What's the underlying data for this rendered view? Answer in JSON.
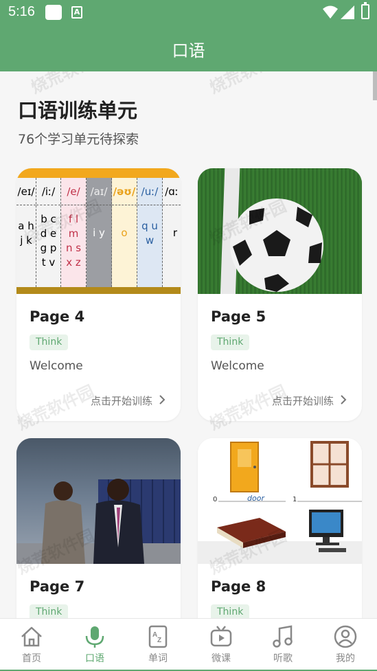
{
  "status_bar": {
    "time": "5:16",
    "a_icon": "A"
  },
  "header": {
    "title": "口语"
  },
  "page": {
    "heading": "口语训练单元",
    "subheading": "76个学习单元待探索"
  },
  "cards": [
    {
      "title": "Page 4",
      "tag": "Think",
      "desc": "Welcome",
      "action": "点击开始训练"
    },
    {
      "title": "Page 5",
      "tag": "Think",
      "desc": "Welcome",
      "action": "点击开始训练"
    },
    {
      "title": "Page 7",
      "tag": "Think"
    },
    {
      "title": "Page 8",
      "tag": "Think"
    }
  ],
  "phonics": {
    "headers": [
      "/eɪ/",
      "/iː/",
      "/e/",
      "/aɪ/",
      "/əʊ/",
      "/uː/",
      "/ɑː"
    ],
    "bodies": [
      [
        "a h",
        "j k"
      ],
      [
        "b c",
        "d e",
        "g p",
        "t v"
      ],
      [
        "f l",
        "m",
        "n s",
        "x z"
      ],
      [
        "i y"
      ],
      [
        "o"
      ],
      [
        "q u",
        "w"
      ],
      [
        "r"
      ]
    ]
  },
  "objects_labels": {
    "n0": "0",
    "word": "door",
    "n1": "1"
  },
  "watermark": "烧荒软件园",
  "nav": {
    "items": [
      {
        "label": "首页",
        "icon": "home-icon"
      },
      {
        "label": "口语",
        "icon": "microphone-icon"
      },
      {
        "label": "单词",
        "icon": "dictionary-icon"
      },
      {
        "label": "微课",
        "icon": "tv-icon"
      },
      {
        "label": "听歌",
        "icon": "music-note-icon"
      },
      {
        "label": "我的",
        "icon": "user-icon"
      }
    ],
    "active_index": 1
  },
  "colors": {
    "brand": "#5fa871",
    "tag_bg": "#e8f3ea"
  }
}
